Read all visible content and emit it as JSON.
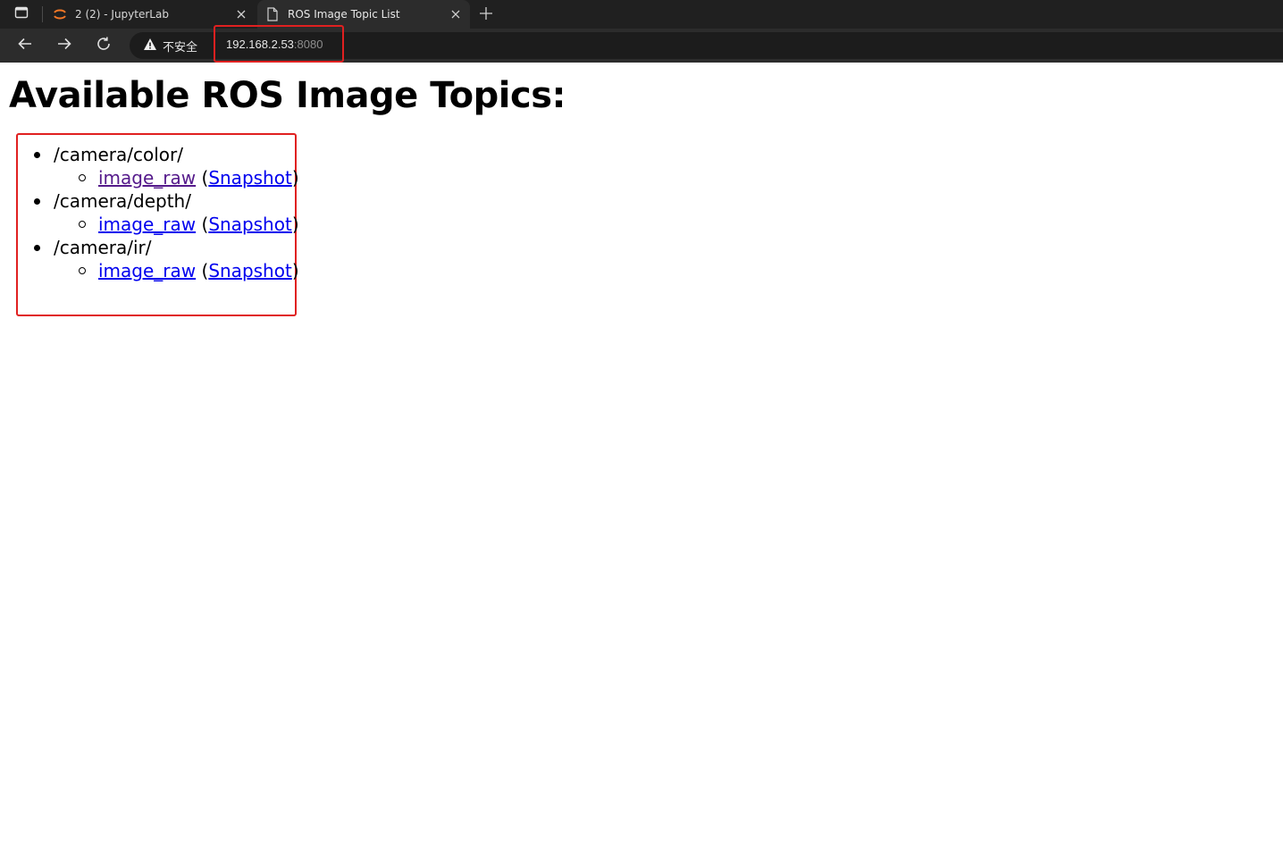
{
  "browser": {
    "tabs": [
      {
        "title": "2 (2) - JupyterLab",
        "active": false
      },
      {
        "title": "ROS Image Topic List",
        "active": true
      }
    ],
    "security_label": "不安全",
    "url_host": "192.168.2.53",
    "url_port": ":8080"
  },
  "page": {
    "heading": "Available ROS Image Topics:",
    "groups": [
      {
        "path": "/camera/color/",
        "topic": "image_raw",
        "open_paren": "(",
        "snapshot": "Snapshot",
        "close_paren": ")"
      },
      {
        "path": "/camera/depth/",
        "topic": "image_raw",
        "open_paren": "(",
        "snapshot": "Snapshot",
        "close_paren": ")"
      },
      {
        "path": "/camera/ir/",
        "topic": "image_raw",
        "open_paren": "(",
        "snapshot": "Snapshot",
        "close_paren": ")"
      }
    ]
  },
  "colors": {
    "highlight": "#e02020",
    "link": "#0000ee",
    "visited_link": "#551a8b",
    "chrome_dark": "#202020"
  },
  "icons": [
    "sidebar-toggle-icon",
    "jupyter-icon",
    "close-icon",
    "page-icon",
    "plus-icon",
    "back-arrow-icon",
    "forward-arrow-icon",
    "reload-icon",
    "warning-icon"
  ]
}
